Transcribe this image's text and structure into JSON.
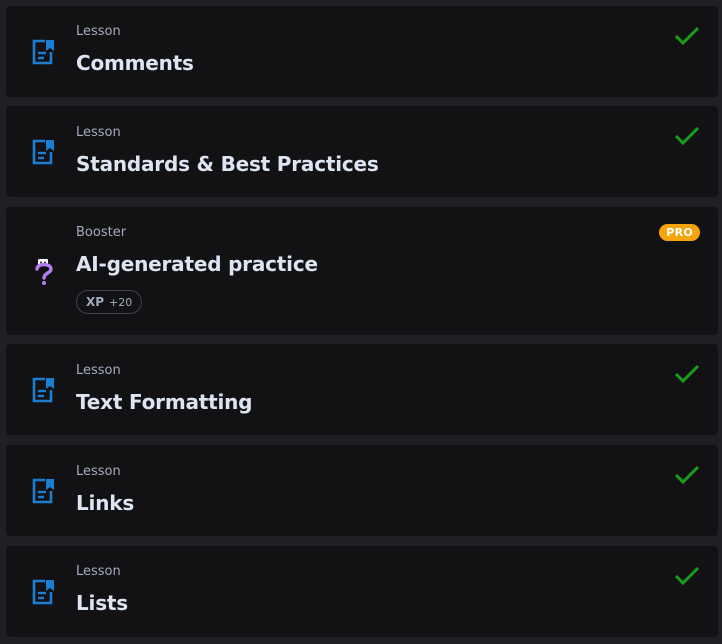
{
  "items": [
    {
      "kind": "Lesson",
      "title": "Comments",
      "icon": "lesson-icon",
      "completed": true
    },
    {
      "kind": "Lesson",
      "title": "Standards & Best Practices",
      "icon": "lesson-icon",
      "completed": true
    },
    {
      "kind": "Booster",
      "title": "AI-generated practice",
      "icon": "question-mark-icon",
      "badge": "PRO",
      "xp_label": "XP",
      "xp_value": "+20"
    },
    {
      "kind": "Lesson",
      "title": "Text Formatting",
      "icon": "lesson-icon",
      "completed": true
    },
    {
      "kind": "Lesson",
      "title": "Links",
      "icon": "lesson-icon",
      "completed": true
    },
    {
      "kind": "Lesson",
      "title": "Lists",
      "icon": "lesson-icon",
      "completed": true
    }
  ],
  "colors": {
    "background": "#1f2024",
    "card": "#121214",
    "lesson_icon": "#1b7fd1",
    "check": "#1a9e1a",
    "pro_badge": "#f5a40c",
    "booster_icon": "#b57ef0"
  }
}
